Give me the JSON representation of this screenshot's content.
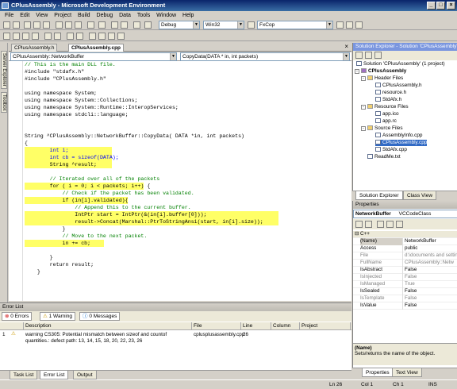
{
  "window": {
    "title": "CPlusAssembly - Microsoft Development Environment"
  },
  "menu": [
    "File",
    "Edit",
    "View",
    "Project",
    "Build",
    "Debug",
    "Data",
    "Tools",
    "Window",
    "Help"
  ],
  "toolbar": {
    "config": "Debug",
    "platform": "Win32",
    "find": "FxCop"
  },
  "side_tabs": [
    "Server Explorer",
    "Toolbox"
  ],
  "doc_tabs": [
    "CPlusAssembly.h",
    "CPlusAssembly.cpp"
  ],
  "nav": {
    "left": "CPlusAssembly::NetworkBuffer",
    "right": "CopyData(DATA * in, int packets)"
  },
  "code": [
    "// This is the main DLL file.",
    "#include \"stdafx.h\"",
    "#include \"CPlusAssembly.h\"",
    "",
    "using namespace System;",
    "using namespace System::Collections;",
    "using namespace System::Runtime::InteropServices;",
    "using namespace stdcli::language;",
    "",
    "",
    "String ^CPlusAssembly::NetworkBuffer::CopyData( DATA *in, int packets)",
    "{",
    "        int i;",
    "        int cb = sizeof(DATA);",
    "        String ^result;",
    "",
    "        // Iterated over all of the packets",
    "        for ( i = 0; i < packets; i++) {",
    "            // Check if the packet has been validated.",
    "            if (in[i].validated){",
    "                // Append this to the current buffer.",
    "                IntPtr start = IntPtr(&(in[i].buffer[0]));",
    "                result->Concat(Marshal::PtrToStringAnsi(start, in[i].size));",
    "            }",
    "            // Move to the next packet.",
    "            in += cb;",
    "",
    "        }",
    "        return result;",
    "    }"
  ],
  "error_list": {
    "title": "Error List",
    "filters": [
      "0 Errors",
      "1 Warning",
      "0 Messages"
    ],
    "columns": [
      "Description",
      "File",
      "Line",
      "Column",
      "Project"
    ],
    "rows": [
      {
        "index": "1",
        "description": "warning CS305: Potential mismatch between sizeof and countof",
        "description2": "quantities.: defect path: 13, 14, 15, 18, 20, 22, 23, 26",
        "file": "cplusplusassembly.cpp",
        "line": "26",
        "column": "",
        "project": ""
      }
    ]
  },
  "bottom_tabs": [
    "Task List",
    "Error List",
    "Output"
  ],
  "status": {
    "ln": "Ln 26",
    "col": "Col 1",
    "ch": "Ch 1",
    "mode": "INS"
  },
  "solution_explorer": {
    "title": "Solution Explorer - Solution 'CPlusAssembly'",
    "nodes": [
      "Solution 'CPlusAssembly' (1 project)",
      "CPlusAssembly",
      "Header Files",
      "CPlusAssembly.h",
      "resource.h",
      "StdAfx.h",
      "Resource Files",
      "app.ico",
      "app.rc",
      "Source Files",
      "AssemblyInfo.cpp",
      "CPlusAssembly.cpp",
      "StdAfx.cpp",
      "ReadMe.txt"
    ],
    "tabs": [
      "Solution Explorer",
      "Class View"
    ]
  },
  "properties": {
    "title": "Properties",
    "object": "NetworkBuffer",
    "object_type": "VCCodeClass",
    "section": "C++",
    "rows": [
      {
        "name": "(Name)",
        "value": "NetworkBuffer"
      },
      {
        "name": "Access",
        "value": "public"
      },
      {
        "name": "File",
        "value": "d:\\documents and setting"
      },
      {
        "name": "FullName",
        "value": "CPlusAssembly::Netw"
      },
      {
        "name": "IsAbstract",
        "value": "False"
      },
      {
        "name": "IsInjected",
        "value": "False"
      },
      {
        "name": "IsManaged",
        "value": "True"
      },
      {
        "name": "IsSealed",
        "value": "False"
      },
      {
        "name": "IsTemplate",
        "value": "False"
      },
      {
        "name": "IsValue",
        "value": "False"
      }
    ],
    "desc_title": "(Name)",
    "desc_text": "Sets/returns the name of the object.",
    "tabs": [
      "Properties",
      "Text View"
    ]
  }
}
